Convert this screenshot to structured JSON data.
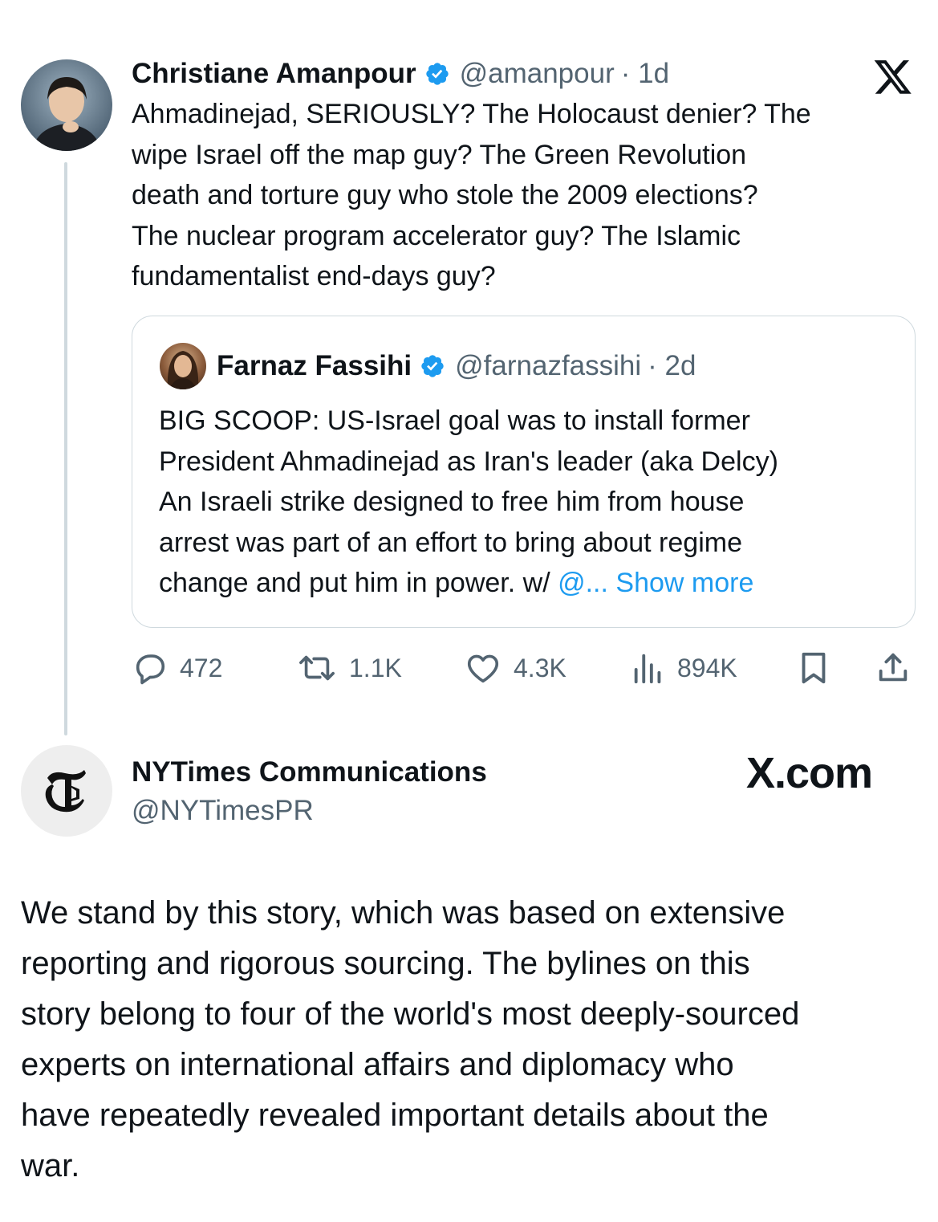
{
  "tweet": {
    "author_name": "Christiane Amanpour",
    "handle": "@amanpour",
    "age": "· 1d",
    "text": "Ahmadinejad, SERIOUSLY? The Holocaust denier? The\nwipe Israel off the map guy? The Green Revolution\ndeath and torture guy who stole the 2009 elections?\nThe nuclear program accelerator guy? The Islamic\nfundamentalist end-days guy?",
    "platform_icon": "x-logo-icon"
  },
  "quoted_tweet": {
    "author_name": "Farnaz Fassihi",
    "handle": "@farnazfassihi",
    "age": "· 2d",
    "text": "BIG SCOOP: US-Israel goal was to install former\nPresident Ahmadinejad as Iran's leader (aka Delcy)\nAn Israeli strike designed to free him from house\narrest was part of an effort to bring about regime\nchange and put him in power. w/ ",
    "mention_truncated": "@...",
    "show_more": " Show more"
  },
  "actions": {
    "replies": "472",
    "reposts": "1.1K",
    "likes": "4.3K",
    "views": "894K"
  },
  "reply": {
    "author_name": "NYTimes Communications",
    "handle": "@NYTimesPR",
    "source_label": "X.com",
    "text": "We stand by this story, which was based on extensive\nreporting and rigorous sourcing. The bylines on this\nstory belong to four of the world's most deeply-sourced\nexperts on international affairs and diplomacy who\nhave repeatedly revealed important details about the\nwar."
  },
  "colors": {
    "verified": "#1d9bf0",
    "link": "#1d9bf0",
    "muted": "#536471",
    "border": "#cfd9de"
  }
}
